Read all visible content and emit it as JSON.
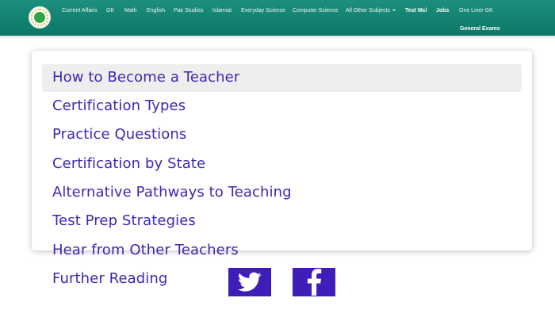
{
  "topnav": {
    "links": [
      "Current Affairs",
      "GK",
      "Math",
      "English",
      "Pak Studies",
      "Islamiat",
      "Everyday Science",
      "Computer Science",
      "All Other Subjects",
      "Test Mcl",
      "Jobs",
      "One Liner GK",
      "General Exams"
    ]
  },
  "menu": {
    "items": [
      "How to Become a Teacher",
      "Certification Types",
      "Practice Questions",
      "Certification by State",
      "Alternative Pathways to Teaching",
      "Test Prep Strategies",
      "Hear from Other Teachers",
      "Further Reading"
    ]
  },
  "social": {
    "twitter_icon": "twitter-icon",
    "facebook_icon": "facebook-icon",
    "color": "#3f1db8"
  },
  "colors": {
    "nav": "#0d7767",
    "link": "#3a2ab0"
  }
}
